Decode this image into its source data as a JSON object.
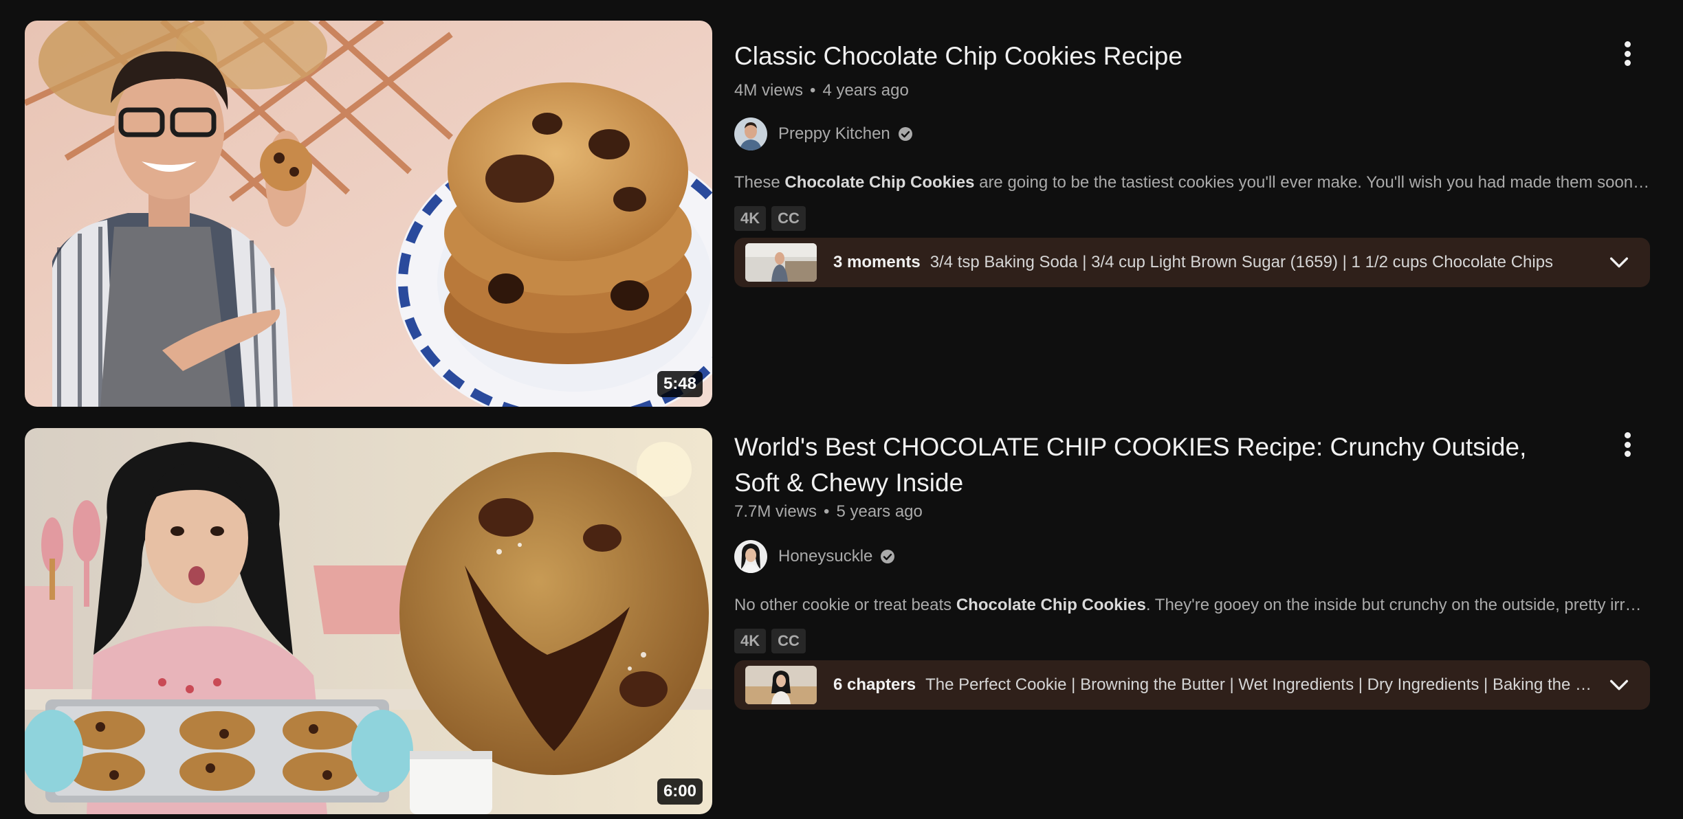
{
  "videos": [
    {
      "title": "Classic Chocolate Chip Cookies Recipe",
      "views": "4M views",
      "separator": "•",
      "age": "4 years ago",
      "duration": "5:48",
      "channel": "Preppy Kitchen",
      "description": {
        "before": "These ",
        "highlight": "Chocolate Chip Cookies",
        "after": " are going to be the tastiest cookies you'll ever make. You'll wish you had made them sooner!"
      },
      "badges": [
        "4K",
        "CC"
      ],
      "moments": {
        "count": "3 moments",
        "list": "3/4 tsp Baking Soda | 3/4 cup Light Brown Sugar (1659) | 1 1/2 cups Chocolate Chips"
      }
    },
    {
      "title": "World's Best CHOCOLATE CHIP COOKIES Recipe: Crunchy Outside, Soft & Chewy Inside",
      "views": "7.7M views",
      "separator": "•",
      "age": "5 years ago",
      "duration": "6:00",
      "channel": "Honeysuckle",
      "description": {
        "before": "No other cookie or treat beats ",
        "highlight": "Chocolate Chip Cookies",
        "after": ". They're gooey on the inside but crunchy on the outside, pretty irresistible."
      },
      "badges": [
        "4K",
        "CC"
      ],
      "moments": {
        "count": "6 chapters",
        "list": "The Perfect Cookie | Browning the Butter | Wet Ingredients | Dry Ingredients | Baking the Cookies"
      }
    }
  ],
  "icons": {
    "menu": "more-vert-icon",
    "verified": "verified-check-icon",
    "expand": "chevron-down-icon"
  },
  "colors": {
    "background": "#0f0f0f",
    "moments_bg": "#2f201a",
    "secondary_text": "#aaaaaa"
  }
}
